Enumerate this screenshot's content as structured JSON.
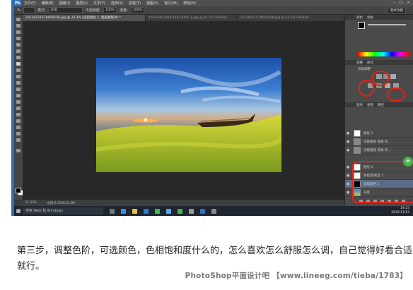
{
  "app": {
    "logo": "Ps",
    "menu": [
      "文件(F)",
      "编辑(E)",
      "图像(I)",
      "图层(L)",
      "文字(Y)",
      "选择(S)",
      "滤镜(T)",
      "视图(V)",
      "窗口(W)",
      "帮助(H)"
    ]
  },
  "options": {
    "mode_label": "模式:",
    "mode_value": "正常",
    "opacity_label": "不透明度:",
    "opacity_value": "100%",
    "flow_label": "流量:",
    "flow_value": "100%",
    "preset": "基本功能"
  },
  "tabs": [
    "20128221574659256.jpg @ 33.3% (选取颜色 1, 图层蒙版/8) *",
    "4562498_080616813000_2.jpg @ 66.7% (RGB/8)",
    "20128221574659208.jpg @ 33.3% (RGB/8)"
  ],
  "statusbar": {
    "zoom": "33.33%",
    "doc": "文档:6.55M/25.4M"
  },
  "panels": {
    "color_tabs": [
      "颜色",
      "色板"
    ],
    "adjust_tabs": [
      "调整",
      "样式"
    ],
    "adjust_title": "添加调整",
    "layer_tabs": [
      "图层",
      "通道",
      "路径"
    ],
    "layers": [
      "图层 3",
      "创建通道 海滩  的...",
      "创建通道 海滩  的...",
      "图层 2",
      "色相/饱和度 1",
      "选取颜色 1",
      "背景"
    ]
  },
  "taskbar": {
    "search_placeholder": "搜索 Web 和 Windows",
    "time": "19:23",
    "date": "2015/11/12"
  },
  "caption": "第三步，调整色阶，可选颜色，色相饱和度什么的，怎么喜欢怎么舒服怎么调，自己觉得好看合适就行。",
  "watermark": "PhotoShop平面设计吧 【www.lineeg.com/tieba/1783】",
  "colors": {
    "accent_blue": "#2f72b8",
    "annotation_red": "#e8201a"
  }
}
